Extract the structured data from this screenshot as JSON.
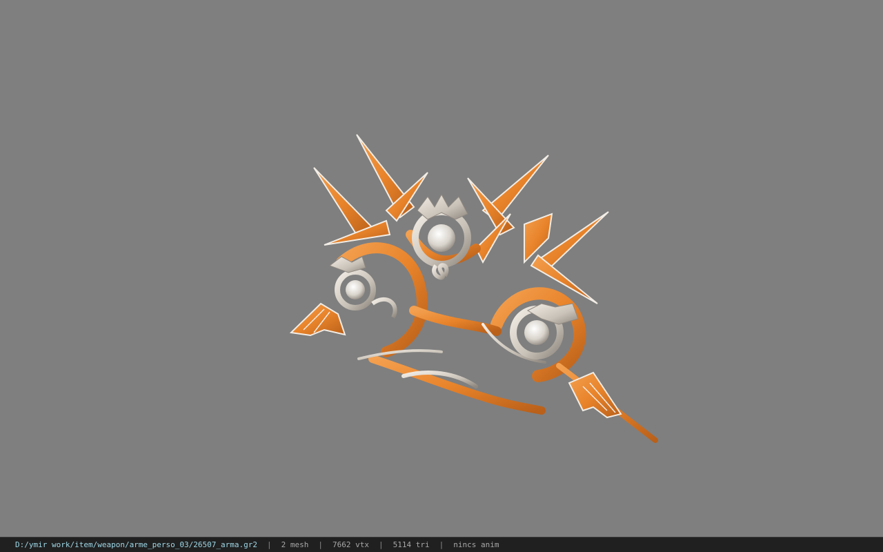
{
  "viewer": {
    "background_color": "#7f7f7f",
    "model_colors": {
      "primary": "#e8832a",
      "secondary": "#c9c2b8",
      "highlight": "#f2ede6",
      "shadow": "#8a4a14"
    }
  },
  "status_bar": {
    "file_path": "D:/ymir work/item/weapon/arme_perso_03/26507_arma.gr2",
    "separator": "|",
    "mesh_count": "2 mesh",
    "vertex_count": "7662 vtx",
    "triangle_count": "5114 tri",
    "animation_status": "nincs anim"
  }
}
